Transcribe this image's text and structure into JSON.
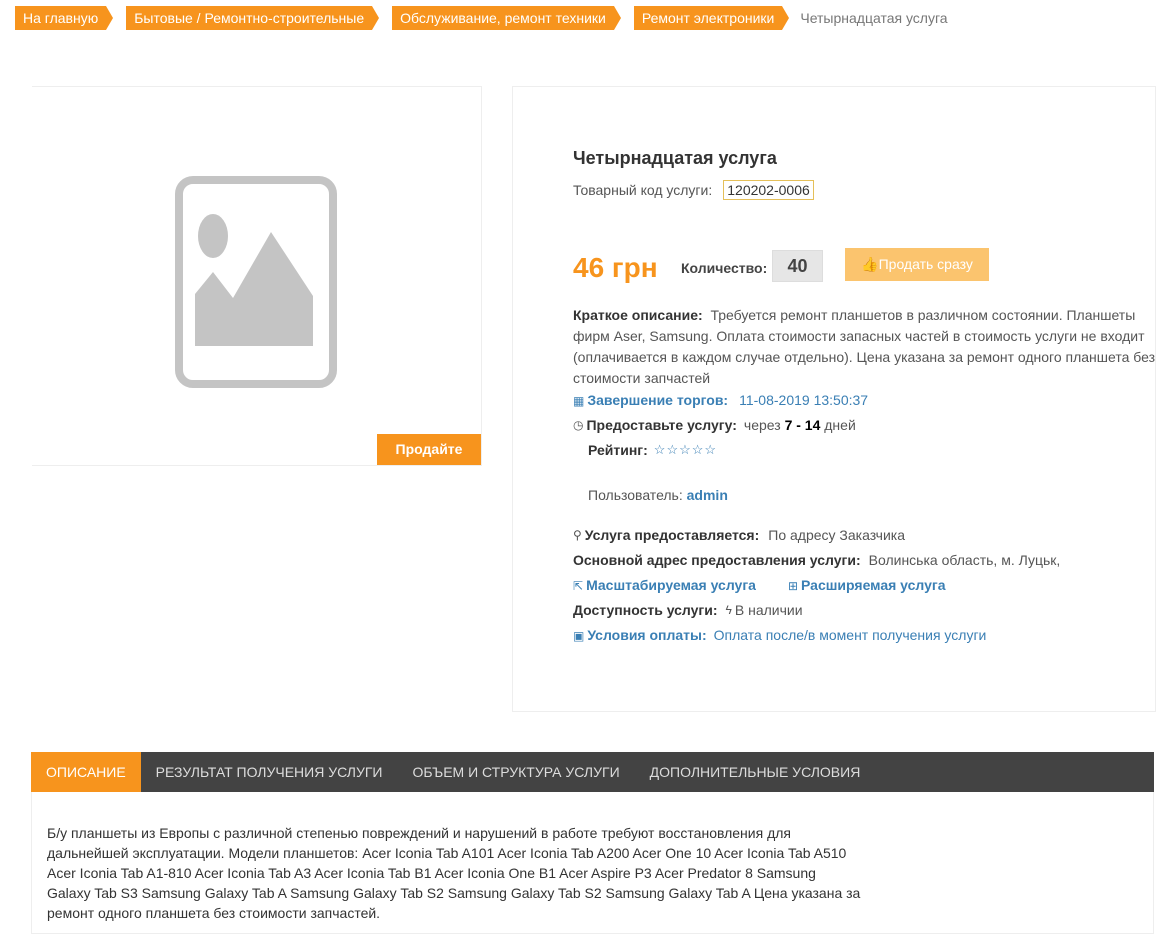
{
  "breadcrumb": {
    "items": [
      "На главную",
      "Бытовые / Ремонтно-строительные",
      "Обслуживание, ремонт техники",
      "Ремонт электроники"
    ],
    "current": "Четырнадцатая услуга"
  },
  "image_panel": {
    "sell_label": "Продайте"
  },
  "product": {
    "title": "Четырнадцатая услуга",
    "code_label": "Товарный код услуги:",
    "code_value": "120202-0006",
    "price": "46 грн",
    "quantity_label": "Количество:",
    "quantity_value": "40",
    "sell_now_label": "Продать сразу",
    "short_desc_label": "Краткое описание:",
    "short_desc_text": "Требуется ремонт планшетов в различном состоянии. Планшеты фирм Aser, Samsung. Оплата стоимости запасных частей в стоимость услуги не входит (оплачивается в каждом случае отдельно). Цена указана за ремонт одного планшета без стоимости запчастей",
    "auction_end_label": "Завершение торгов:",
    "auction_end_value": "11-08-2019 13:50:37",
    "provide_label": "Предоставьте услугу:",
    "provide_prefix": "через",
    "provide_range": "7 - 14",
    "provide_suffix": "дней",
    "rating_label": "Рейтинг:",
    "rating_stars": "☆☆☆☆☆",
    "user_label": "Пользователь:",
    "user_value": "admin",
    "location_label": "Услуга предоставляется:",
    "location_value": "По адресу Заказчика",
    "address_label": "Основной адрес предоставления услуги:",
    "address_value": "Волинська область, м. Луцьк,",
    "scalable_label": "Масштабируемая услуга",
    "expandable_label": "Расширяемая услуга",
    "availability_label": "Доступность услуги:",
    "availability_value": "В наличии",
    "payment_label": "Условия оплаты:",
    "payment_value": "Оплата после/в момент получения услуги"
  },
  "tabs": {
    "items": [
      "ОПИСАНИЕ",
      "РЕЗУЛЬТАТ ПОЛУЧЕНИЯ УСЛУГИ",
      "ОБЪЕМ И СТРУКТУРА УСЛУГИ",
      "ДОПОЛНИТЕЛЬНЫЕ УСЛОВИЯ"
    ],
    "active_content": "Б/у планшеты из Европы с различной степенью повреждений и нарушений в работе требуют восстановления для дальнейшей эксплуатации. Модели планшетов: Acer Iconia Tab A101 Acer Iconia Tab A200 Acer One 10 Acer Iconia Tab A510 Acer Iconia Tab A1-810 Acer Iconia Tab A3 Acer Iconia Tab B1 Acer Iconia One B1 Acer Aspire P3 Acer Predator 8 Samsung Galaxy Tab S3 Samsung Galaxy Tab A Samsung Galaxy Tab S2 Samsung Galaxy Tab S2 Samsung Galaxy Tab A Цена указана за ремонт одного планшета без стоимости запчастей."
  },
  "colors": {
    "accent": "#f7941d",
    "link": "#3a7fb4",
    "tab_bar": "#434343"
  }
}
